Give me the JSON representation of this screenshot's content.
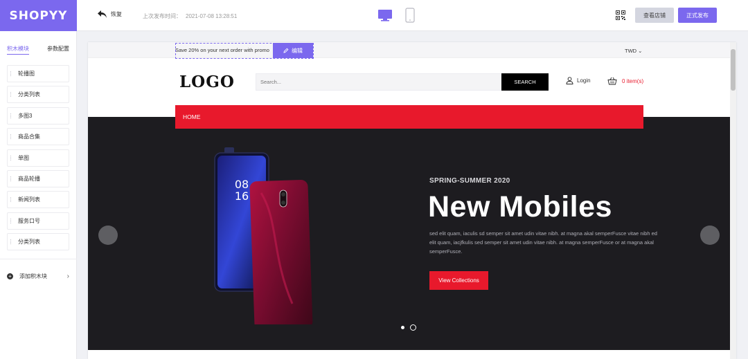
{
  "app": {
    "brand": "SHOPYY",
    "brand_color": "#7b68ee"
  },
  "header": {
    "undo_label": "恢复",
    "publish_time_label": "上次发布时间：",
    "publish_time_value": "2021-07-08 13:28:51",
    "view_store_label": "查看店铺",
    "publish_label": "正式发布",
    "device_selected": "desktop"
  },
  "sidebar": {
    "tabs": [
      {
        "label": "积木模块",
        "active": true
      },
      {
        "label": "参数配置",
        "active": false
      }
    ],
    "blocks": [
      {
        "label": "轮播图"
      },
      {
        "label": "分类列表"
      },
      {
        "label": "多图3"
      },
      {
        "label": "商品合集"
      },
      {
        "label": "单图"
      },
      {
        "label": "商品轮播"
      },
      {
        "label": "新闻列表"
      },
      {
        "label": "服务口号"
      },
      {
        "label": "分类列表"
      }
    ],
    "add_block_label": "添加积木块"
  },
  "preview": {
    "promo_text": "Save 20% on your next order with promo",
    "edit_label": "编辑",
    "currency": "TWD",
    "logo_text": "LOGO",
    "search_placeholder": "Search...",
    "search_button": "SEARCH",
    "login_label": "Login",
    "cart_label": "0 item(s)",
    "nav_items": [
      "HOME"
    ],
    "hero": {
      "kicker": "SPRING-SUMMER 2020",
      "title": "New Mobiles",
      "description": "sed elit quam, iaculis sd semper sit amet udin vitae nibh. at magna akal semperFusce vitae nibh ed elit quam, iacjfkulis sed semper sit amet udin vitae nibh. at magna semperFusce or at magna akal semperFusce.",
      "cta": "View Collections",
      "slide_count": 2,
      "active_slide": 1
    },
    "accent_color": "#e8192c"
  }
}
